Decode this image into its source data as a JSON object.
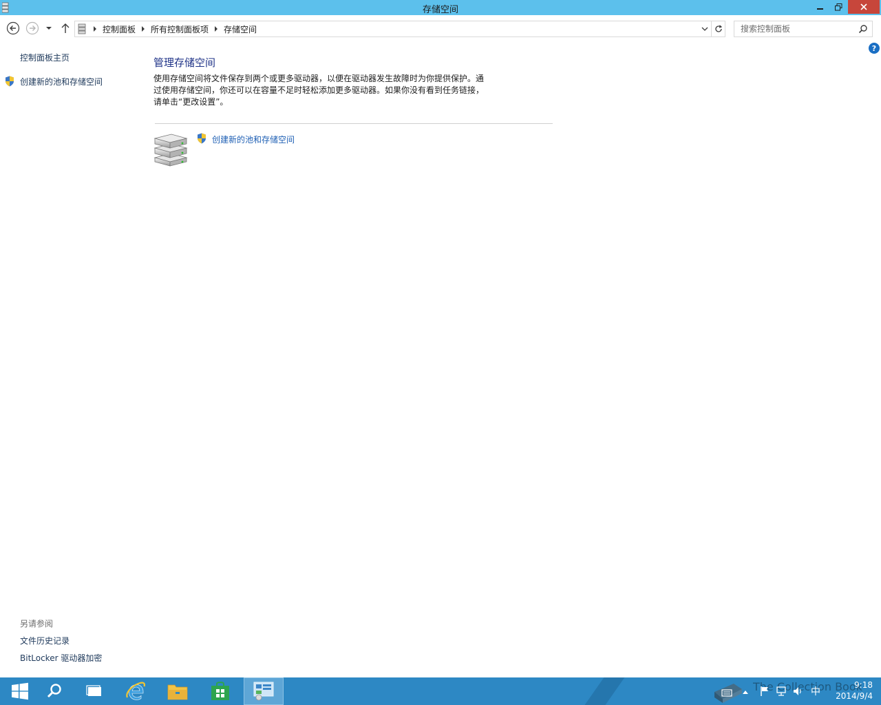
{
  "window": {
    "title": "存储空间"
  },
  "nav": {
    "breadcrumbs": [
      "控制面板",
      "所有控制面板项",
      "存储空间"
    ],
    "search_placeholder": "搜索控制面板"
  },
  "left_pane": {
    "home_link": "控制面板主页",
    "create_link": "创建新的池和存储空间",
    "see_also_heading": "另请参阅",
    "see_also": [
      "文件历史记录",
      "BitLocker 驱动器加密"
    ]
  },
  "main": {
    "title": "管理存储空间",
    "description": "使用存储空间将文件保存到两个或更多驱动器，以便在驱动器发生故障时为你提供保护。通过使用存储空间，你还可以在容量不足时轻松添加更多驱动器。如果你没有看到任务链接，请单击“更改设置”。",
    "task_link": "创建新的池和存储空间"
  },
  "taskbar": {
    "clock_time": "9:18",
    "clock_date": "2014/9/4",
    "ime_label": "中",
    "watermark": "The Collection Book"
  },
  "colors": {
    "titlebar": "#5cc0ec",
    "taskbar": "#2d88c4",
    "link": "#1e5fb4",
    "heading": "#1e3287",
    "close_button": "#c7463b"
  },
  "icons": [
    "storage-spaces-icon",
    "back-arrow-icon",
    "forward-arrow-icon",
    "recent-dropdown-icon",
    "up-arrow-icon",
    "refresh-icon",
    "search-icon",
    "uac-shield-icon",
    "help-icon",
    "start-icon",
    "ie-icon",
    "file-explorer-icon",
    "store-icon",
    "control-panel-icon",
    "action-center-flag-icon",
    "network-icon",
    "volume-icon"
  ]
}
